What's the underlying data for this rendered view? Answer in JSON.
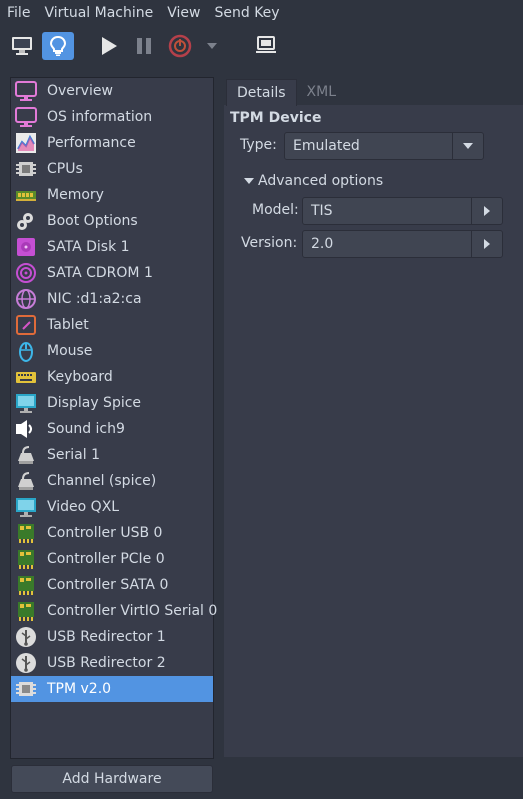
{
  "menubar": [
    "File",
    "Virtual Machine",
    "View",
    "Send Key"
  ],
  "toolbar": {
    "icons": [
      "monitor-icon",
      "lightbulb-icon",
      "play-icon",
      "pause-icon",
      "power-icon",
      "dropdown-arrow-icon",
      "screenshot-icon"
    ],
    "accent_color": "#5294e2"
  },
  "sidebar": {
    "items": [
      {
        "label": "Overview",
        "icon": "overview-monitor-icon"
      },
      {
        "label": "OS information",
        "icon": "os-monitor-icon"
      },
      {
        "label": "Performance",
        "icon": "performance-chart-icon"
      },
      {
        "label": "CPUs",
        "icon": "cpu-chip-icon"
      },
      {
        "label": "Memory",
        "icon": "memory-stick-icon"
      },
      {
        "label": "Boot Options",
        "icon": "gears-icon"
      },
      {
        "label": "SATA Disk 1",
        "icon": "disk-icon"
      },
      {
        "label": "SATA CDROM 1",
        "icon": "cdrom-icon"
      },
      {
        "label": "NIC :d1:a2:ca",
        "icon": "network-globe-icon"
      },
      {
        "label": "Tablet",
        "icon": "tablet-icon"
      },
      {
        "label": "Mouse",
        "icon": "mouse-icon"
      },
      {
        "label": "Keyboard",
        "icon": "keyboard-icon"
      },
      {
        "label": "Display Spice",
        "icon": "display-icon"
      },
      {
        "label": "Sound ich9",
        "icon": "sound-icon"
      },
      {
        "label": "Serial 1",
        "icon": "serial-port-icon"
      },
      {
        "label": "Channel (spice)",
        "icon": "channel-port-icon"
      },
      {
        "label": "Video QXL",
        "icon": "video-monitor-icon"
      },
      {
        "label": "Controller USB 0",
        "icon": "controller-card-icon"
      },
      {
        "label": "Controller PCIe 0",
        "icon": "controller-card-icon"
      },
      {
        "label": "Controller SATA 0",
        "icon": "controller-card-icon"
      },
      {
        "label": "Controller VirtIO Serial 0",
        "icon": "controller-card-icon"
      },
      {
        "label": "USB Redirector 1",
        "icon": "usb-icon"
      },
      {
        "label": "USB Redirector 2",
        "icon": "usb-icon"
      },
      {
        "label": "TPM v2.0",
        "icon": "tpm-chip-icon"
      }
    ],
    "selected_index": 23,
    "add_button": "Add Hardware"
  },
  "tabs": [
    "Details",
    "XML"
  ],
  "details": {
    "section_title": "TPM Device",
    "type_label": "Type:",
    "type_value": "Emulated",
    "expander_label": "Advanced options",
    "model_label": "Model:",
    "model_value": "TIS",
    "version_label": "Version:",
    "version_value": "2.0"
  }
}
